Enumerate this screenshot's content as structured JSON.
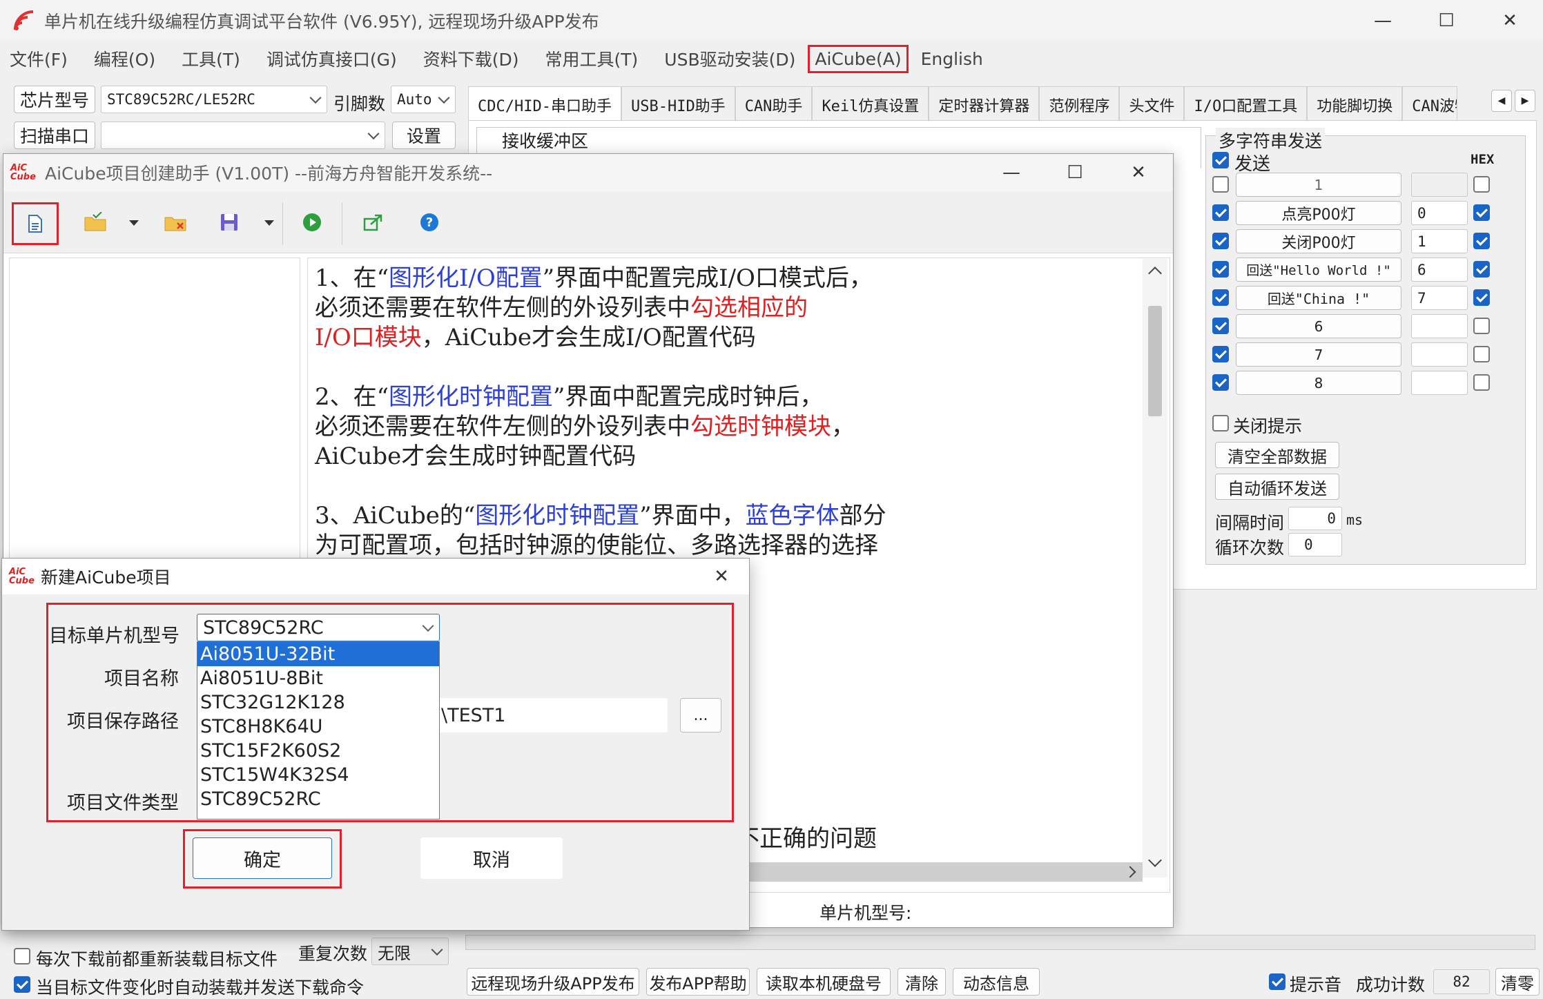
{
  "main_window": {
    "title": "单片机在线升级编程仿真调试平台软件 (V6.95Y), 远程现场升级APP发布",
    "menu": [
      "文件(F)",
      "编程(O)",
      "工具(T)",
      "调试仿真接口(G)",
      "资料下载(D)",
      "常用工具(T)",
      "USB驱动安装(D)",
      "AiCube(A)",
      "English"
    ],
    "chip_label": "芯片型号",
    "chip_value": "STC89C52RC/LE52RC",
    "pin_label": "引脚数",
    "pin_value": "Auto",
    "scan_label": "扫描串口",
    "settings_label": "设置",
    "tabs": [
      "CDC/HID-串口助手",
      "USB-HID助手",
      "CAN助手",
      "Keil仿真设置",
      "定时器计算器",
      "范例程序",
      "头文件",
      "I/O口配置工具",
      "功能脚切换",
      "CAN波特"
    ],
    "recv_label": "接收缓冲区",
    "multi": {
      "title": "多字符串发送",
      "send_label": "发送",
      "hex_label": "HEX",
      "rows": [
        {
          "label": "1",
          "value": ""
        },
        {
          "label": "点亮P00灯",
          "value": "0"
        },
        {
          "label": "关闭P00灯",
          "value": "1"
        },
        {
          "label": "回送\"Hello World !\"",
          "value": "6"
        },
        {
          "label": "回送\"China !\"",
          "value": "7"
        },
        {
          "label": "6",
          "value": ""
        },
        {
          "label": "7",
          "value": ""
        },
        {
          "label": "8",
          "value": ""
        }
      ],
      "close_hint": "关闭提示",
      "clear_all": "清空全部数据",
      "auto_loop": "自动循环发送",
      "interval_label": "间隔时间",
      "interval_value": "0",
      "interval_unit": "ms",
      "loop_label": "循环次数",
      "loop_value": "0"
    },
    "bottom": {
      "reload_label": "每次下载前都重新装载目标文件",
      "auto_label": "当目标文件变化时自动装载并发送下载命令",
      "repeat_label": "重复次数",
      "repeat_value": "无限",
      "buttons": [
        "远程现场升级APP发布",
        "发布APP帮助",
        "读取本机硬盘号",
        "清除",
        "动态信息"
      ],
      "beep_label": "提示音",
      "success_label": "成功计数",
      "success_value": "82",
      "reset_label": "清零"
    }
  },
  "aicube_window": {
    "title": "AiCube项目创建助手 (V1.00T) --前海方舟智能开发系统--",
    "logo": "AiC Cube",
    "help_lines": [
      [
        {
          "t": "1、在“"
        },
        {
          "t": "图形化I/O配置",
          "c": "blue"
        },
        {
          "t": "”界面中配置完成I/O口模式后，"
        }
      ],
      [
        {
          "t": "   必须还需要在软件左侧的外设列表中"
        },
        {
          "t": "勾选相应的",
          "c": "red"
        }
      ],
      [
        {
          "t": "   "
        },
        {
          "t": "I/O口模块",
          "c": "red"
        },
        {
          "t": "，AiCube才会生成I/O配置代码"
        }
      ],
      [
        {
          "t": ""
        }
      ],
      [
        {
          "t": "2、在“"
        },
        {
          "t": "图形化时钟配置",
          "c": "blue"
        },
        {
          "t": "”界面中配置完成时钟后，"
        }
      ],
      [
        {
          "t": "   必须还需要在软件左侧的外设列表中"
        },
        {
          "t": "勾选时钟模块",
          "c": "red"
        },
        {
          "t": "，"
        }
      ],
      [
        {
          "t": "   AiCube才会生成时钟配置代码"
        }
      ],
      [
        {
          "t": ""
        }
      ],
      [
        {
          "t": "3、AiCube的“"
        },
        {
          "t": "图形化时钟配置",
          "c": "blue"
        },
        {
          "t": "”界面中，"
        },
        {
          "t": "蓝色字体",
          "c": "blue"
        },
        {
          "t": "部分"
        }
      ],
      [
        {
          "t": "   为可配置项，包括时钟源的使能位、多路选择器的选择"
        }
      ]
    ],
    "help_tail": "不正确的问题",
    "status_label": "单片机型号:"
  },
  "dialog": {
    "title": "新建AiCube项目",
    "target_label": "目标单片机型号",
    "target_value": "STC89C52RC",
    "name_label": "项目名称",
    "path_label": "项目保存路径",
    "path_value": "\\TEST1",
    "browse_label": "...",
    "type_label": "项目文件类型",
    "options": [
      "Ai8051U-32Bit",
      "Ai8051U-8Bit",
      "STC32G12K128",
      "STC8H8K64U",
      "STC15F2K60S2",
      "STC15W4K32S4",
      "STC89C52RC"
    ],
    "ok_label": "确定",
    "cancel_label": "取消"
  }
}
